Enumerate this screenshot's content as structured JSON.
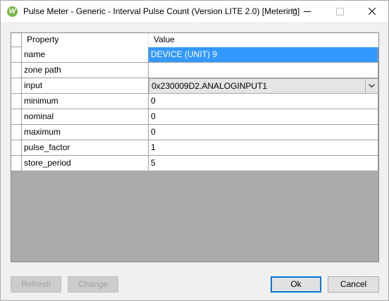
{
  "window": {
    "title": "Pulse Meter - Generic - Interval Pulse Count (Version LITE 2.0) [Metering]",
    "resize_cursor": "↔",
    "icon": "app-logo-icon"
  },
  "grid": {
    "headers": {
      "property": "Property",
      "value": "Value"
    },
    "rows": [
      {
        "property": "name",
        "value": "DEVICE (UNIT) 9"
      },
      {
        "property": "zone path",
        "value": ""
      },
      {
        "property": "input",
        "value": "0x230009D2.ANALOGINPUT1"
      },
      {
        "property": "minimum",
        "value": "0"
      },
      {
        "property": "nominal",
        "value": "0"
      },
      {
        "property": "maximum",
        "value": "0"
      },
      {
        "property": "pulse_factor",
        "value": "1"
      },
      {
        "property": "store_period",
        "value": "5"
      }
    ]
  },
  "buttons": {
    "refresh": "Refresh",
    "change": "Change",
    "ok": "Ok",
    "cancel": "Cancel"
  },
  "colors": {
    "selection": "#3399ff",
    "grid_background": "#ababab",
    "default_button_border": "#0078d7"
  }
}
